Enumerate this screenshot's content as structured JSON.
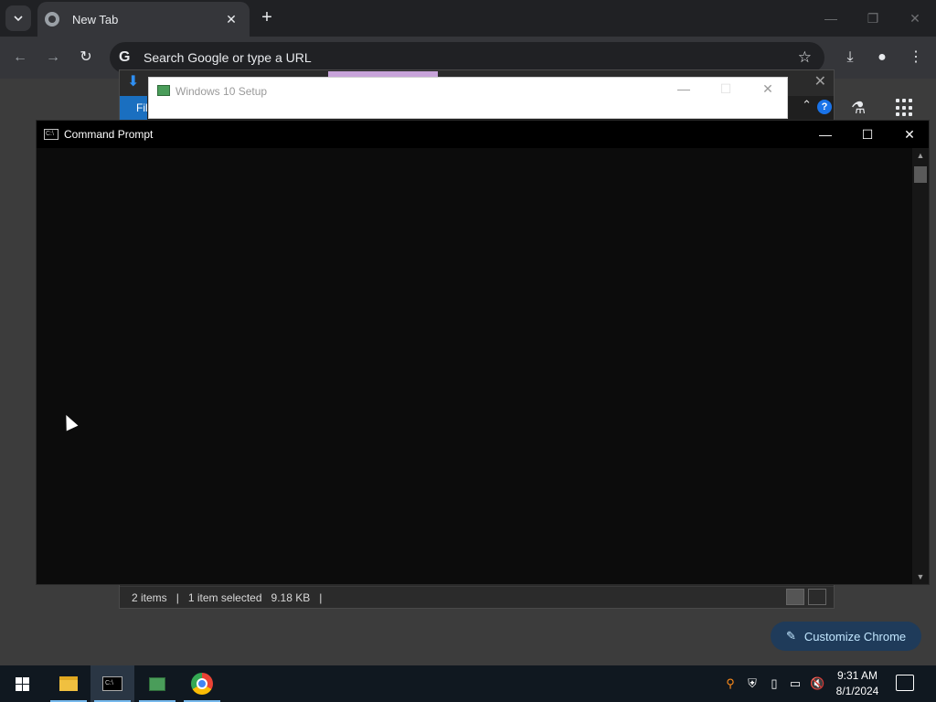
{
  "chrome": {
    "tab": {
      "title": "New Tab"
    },
    "omnibox": {
      "placeholder": "Search Google or type a URL"
    },
    "customize_label": "Customize Chrome"
  },
  "explorer": {
    "file_tab": "Fil",
    "status": {
      "items": "2 items",
      "selected": "1 item selected",
      "size": "9.18 KB"
    }
  },
  "setup": {
    "title": "Windows 10 Setup"
  },
  "cmd": {
    "title": "Command Prompt",
    "icon_text": "C:\\"
  },
  "taskbar": {
    "apps": [
      "File Explorer",
      "Command Prompt",
      "Windows 10 Setup",
      "Google Chrome"
    ],
    "clock": {
      "time": "9:31 AM",
      "date": "8/1/2024"
    }
  },
  "colors": {
    "accent": "#1a73e8",
    "taskbar": "#101820",
    "cmd_bg": "#0c0c0c"
  }
}
